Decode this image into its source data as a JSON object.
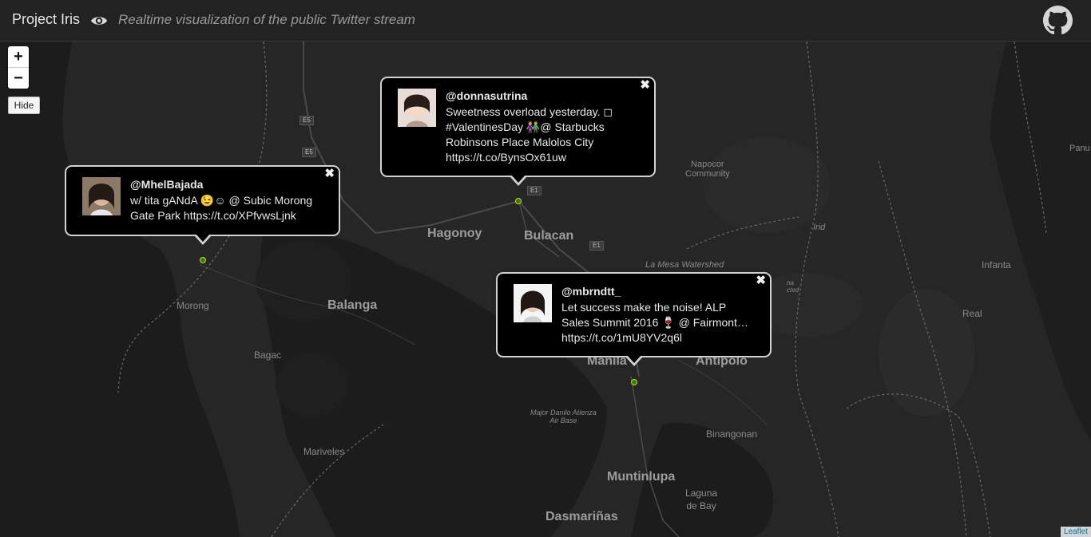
{
  "header": {
    "title": "Project Iris",
    "tagline": "Realtime visualization of the public Twitter stream",
    "icons": [
      "eye-icon",
      "github-icon"
    ]
  },
  "map_controls": {
    "zoom_in": "+",
    "zoom_out": "−",
    "hide_label": "Hide"
  },
  "map_labels": {
    "hagonoy": "Hagonoy",
    "bulacan": "Bulacan",
    "balanga": "Balanga",
    "morong": "Morong",
    "bagac": "Bagac",
    "mariveles": "Mariveles",
    "manila": "Manila",
    "antipolo": "Antipolo",
    "muntinlupa": "Muntinlupa",
    "dasmarinas": "Dasmariñas",
    "binangonan": "Binangonan",
    "laguna_de_bay": "Laguna\nde Bay",
    "napocor": "Napocor\nCommunity",
    "la_mesa": "La Mesa Watershed",
    "infanta": "Infanta",
    "real": "Real",
    "iria": "Irid",
    "airbase": "Major Danilo Atienza\nAir Base",
    "panu": "Panu",
    "protected": "na\ncted",
    "e1": "E1",
    "e5": "E5"
  },
  "tweets": [
    {
      "handle": "@donnasutrina",
      "lines": [
        "Sweetness overload yesterday. ◻",
        "#ValentinesDay 👫@ Starbucks",
        "Robinsons Place Malolos City",
        "https://t.co/BynsOx61uw"
      ]
    },
    {
      "handle": "@MhelBajada",
      "lines": [
        "w/ tita gANdA 😉☺ @ Subic Morong",
        "Gate Park https://t.co/XPfvwsLjnk"
      ]
    },
    {
      "handle": "@mbrndtt_",
      "lines": [
        "Let success make the noise! ALP",
        "Sales Summit 2016 🍷 @ Fairmont…",
        "https://t.co/1mU8YV2q6l"
      ]
    }
  ],
  "attribution": "Leaflet",
  "colors": {
    "background": "#262626",
    "topbar": "#222222",
    "popup_border": "#d2d2d2",
    "marker": "#2c7a2c"
  }
}
